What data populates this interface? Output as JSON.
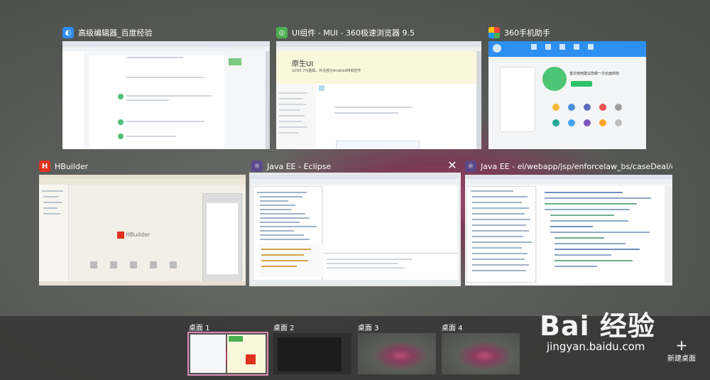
{
  "windows": [
    {
      "title": "高级编辑器_百度经验",
      "icon_color": "#2f8cf2"
    },
    {
      "title": "UI组件 - MUI - 360极速浏览器 9.5",
      "icon_color": "#4caf50",
      "content_heading": "原生UI",
      "content_sub": "以iOS 7为基础，补充部分Android特有控件"
    },
    {
      "title": "360手机助手",
      "icon_color": "#2db04a",
      "content_text": "首次使用建议您做一次全面体检"
    },
    {
      "title": "HBuilder",
      "icon_color": "#e0321f",
      "icon_letter": "H",
      "content_logo": "HBuilder"
    },
    {
      "title": "Java EE - Eclipse",
      "icon_color": "#5b4a8a",
      "close_glyph": "✕"
    },
    {
      "title": "Java EE - el/webapp/jsp/enforcelaw_bs/caseDeal/cform/f...",
      "icon_color": "#5b4a8a"
    }
  ],
  "desktops": [
    {
      "label": "桌面 1",
      "active": true
    },
    {
      "label": "桌面 2",
      "active": false
    },
    {
      "label": "桌面 3",
      "active": false
    },
    {
      "label": "桌面 4",
      "active": false
    }
  ],
  "new_desktop": {
    "plus": "+",
    "label": "新建桌面"
  },
  "watermark": {
    "logo": "Bai 经验",
    "url": "jingyan.baidu.com"
  }
}
